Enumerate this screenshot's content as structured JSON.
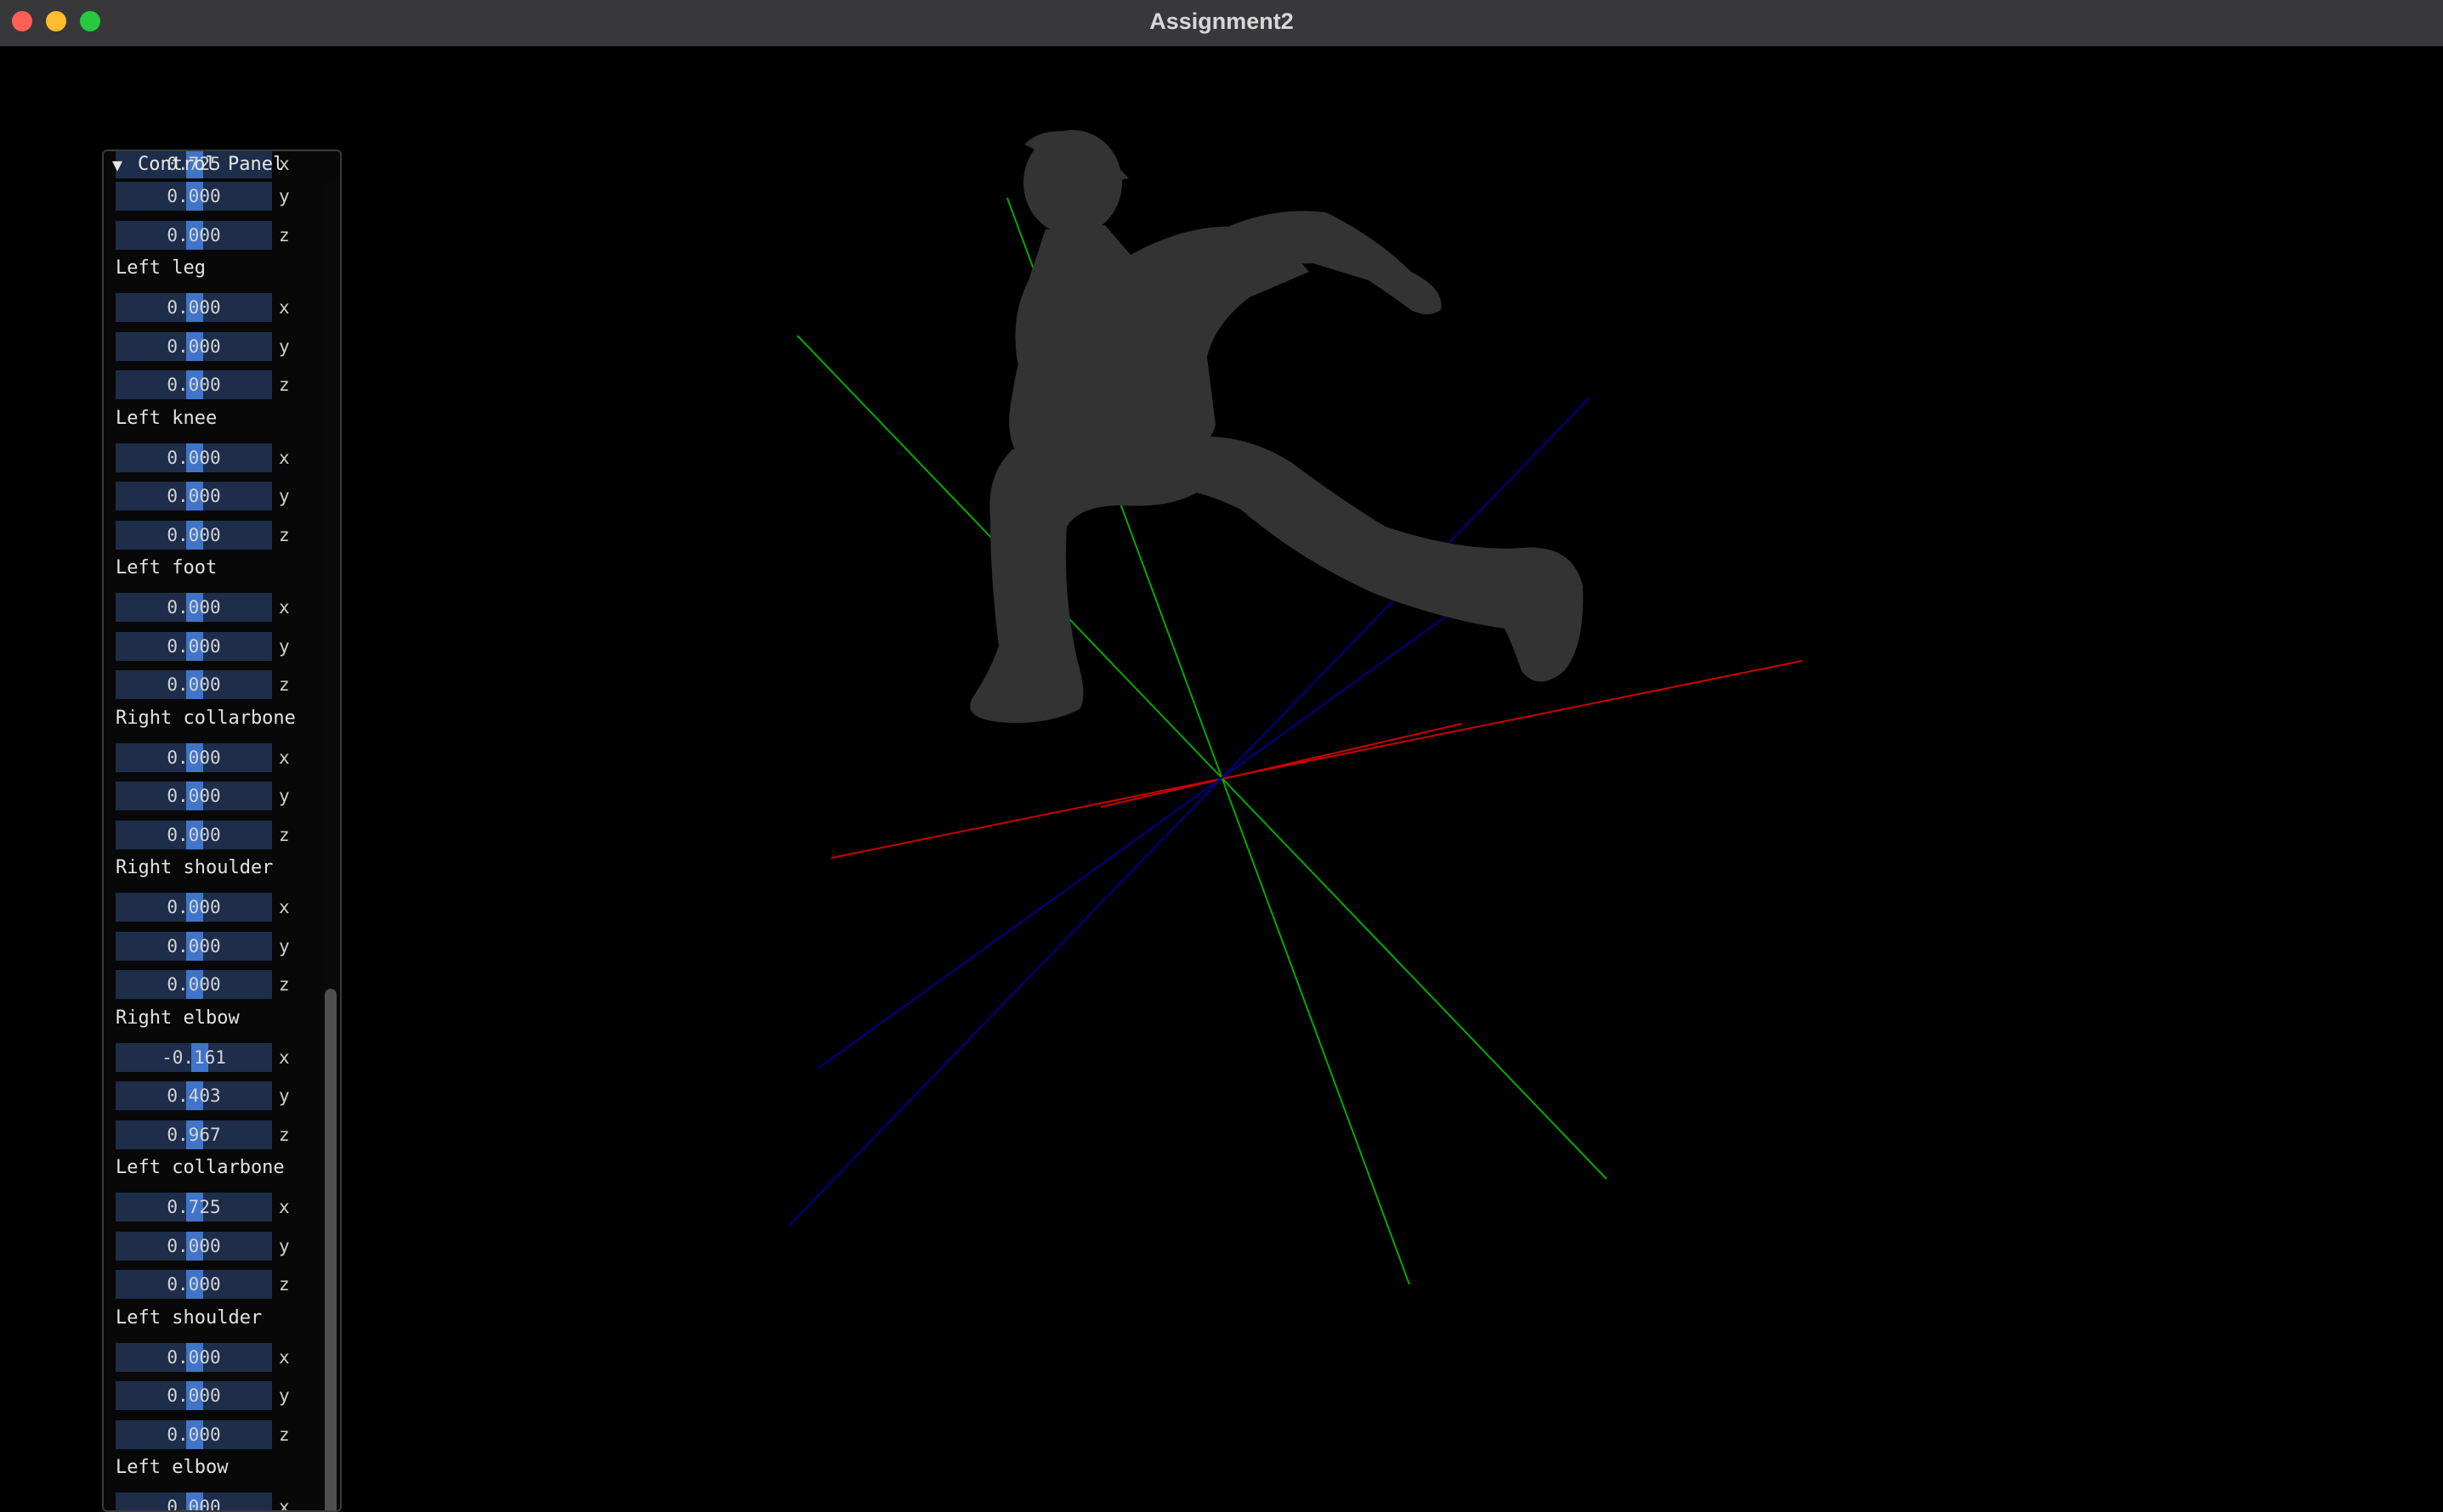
{
  "window": {
    "title": "Assignment2"
  },
  "panel": {
    "title": "Control Panel",
    "arrow": "▼",
    "partial_top": {
      "value": "0.725",
      "axis": "x"
    },
    "groups": [
      {
        "label": "",
        "fields": [
          {
            "value": "0.000",
            "axis": "y"
          },
          {
            "value": "0.000",
            "axis": "z"
          }
        ]
      },
      {
        "label": "Left leg",
        "fields": [
          {
            "value": "0.000",
            "axis": "x"
          },
          {
            "value": "0.000",
            "axis": "y"
          },
          {
            "value": "0.000",
            "axis": "z"
          }
        ]
      },
      {
        "label": "Left knee",
        "fields": [
          {
            "value": "0.000",
            "axis": "x"
          },
          {
            "value": "0.000",
            "axis": "y"
          },
          {
            "value": "0.000",
            "axis": "z"
          }
        ]
      },
      {
        "label": "Left foot",
        "fields": [
          {
            "value": "0.000",
            "axis": "x"
          },
          {
            "value": "0.000",
            "axis": "y"
          },
          {
            "value": "0.000",
            "axis": "z"
          }
        ]
      },
      {
        "label": "Right collarbone",
        "fields": [
          {
            "value": "0.000",
            "axis": "x"
          },
          {
            "value": "0.000",
            "axis": "y"
          },
          {
            "value": "0.000",
            "axis": "z"
          }
        ]
      },
      {
        "label": "Right shoulder",
        "fields": [
          {
            "value": "0.000",
            "axis": "x"
          },
          {
            "value": "0.000",
            "axis": "y"
          },
          {
            "value": "0.000",
            "axis": "z"
          }
        ]
      },
      {
        "label": "Right elbow",
        "fields": [
          {
            "value": "-0.161",
            "axis": "x"
          },
          {
            "value": "0.403",
            "axis": "y"
          },
          {
            "value": "0.967",
            "axis": "z"
          }
        ]
      },
      {
        "label": "Left collarbone",
        "fields": [
          {
            "value": "0.725",
            "axis": "x"
          },
          {
            "value": "0.000",
            "axis": "y"
          },
          {
            "value": "0.000",
            "axis": "z"
          }
        ]
      },
      {
        "label": "Left shoulder",
        "fields": [
          {
            "value": "0.000",
            "axis": "x"
          },
          {
            "value": "0.000",
            "axis": "y"
          },
          {
            "value": "0.000",
            "axis": "z"
          }
        ]
      },
      {
        "label": "Left elbow",
        "fields": [
          {
            "value": "0.000",
            "axis": "x"
          }
        ]
      }
    ]
  },
  "scene": {
    "figure_color": "#333333",
    "axis_colors": {
      "x": "#cc0000",
      "y": "#00aa00",
      "z": "#000088"
    }
  }
}
